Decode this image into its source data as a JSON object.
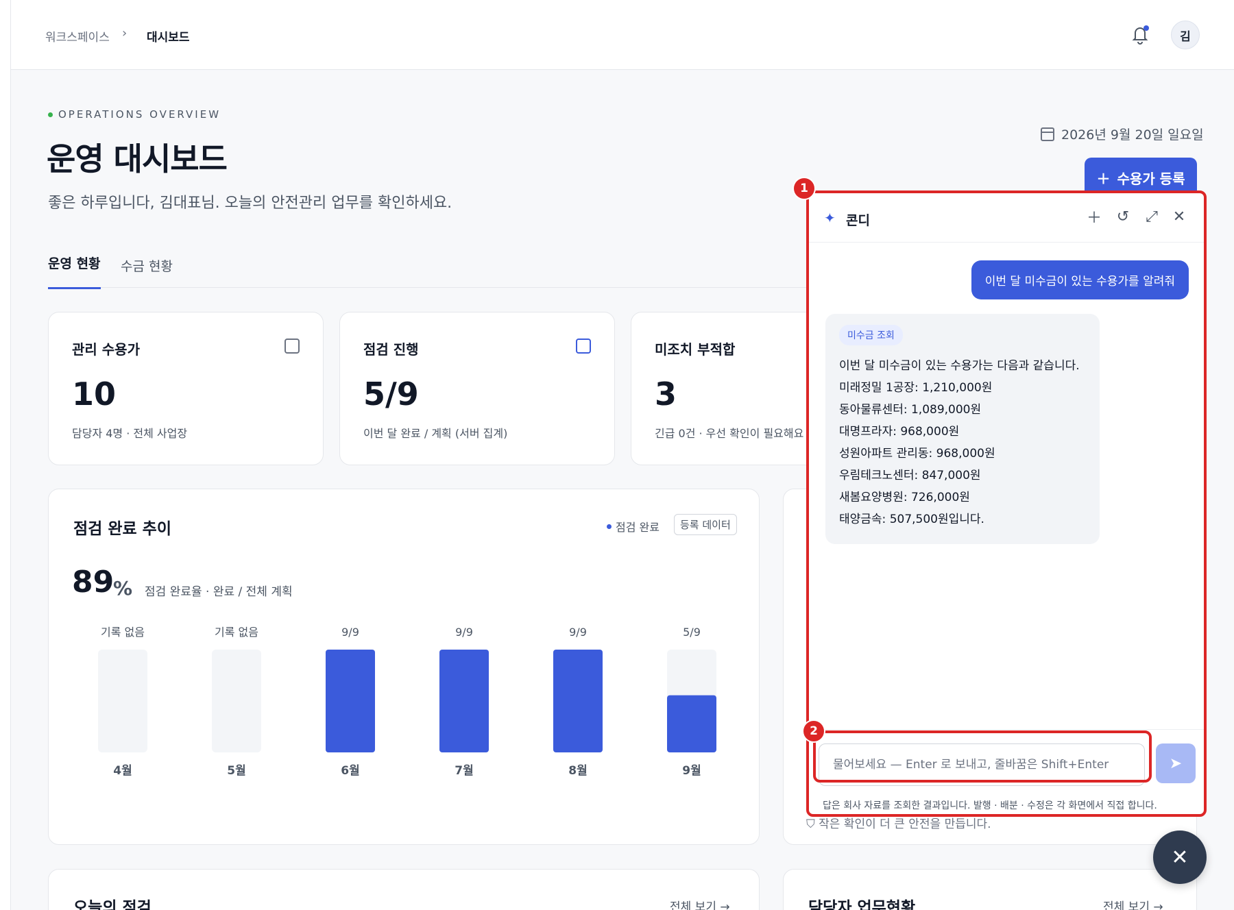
{
  "breadcrumb": {
    "root": "워크스페이스",
    "separator": "›",
    "current": "대시보드"
  },
  "header": {
    "avatar_initial": "김"
  },
  "hero": {
    "eyebrow": "OPERATIONS OVERVIEW",
    "title": "운영 대시보드",
    "subtitle": "좋은 하루입니다, 김대표님. 오늘의 안전관리 업무를 확인하세요.",
    "date": "2026년 9월 20일 일요일",
    "add_button": "수용가 등록"
  },
  "tabs": [
    {
      "label": "운영 현황",
      "active": true
    },
    {
      "label": "수금 현황",
      "active": false
    }
  ],
  "kpis": [
    {
      "title": "관리 수용가",
      "value": "10",
      "sub": "담당자 4명 · 전체 사업장"
    },
    {
      "title": "점검 진행",
      "value": "5/9",
      "sub": "이번 달 완료 / 계획 (서버 집계)"
    },
    {
      "title": "미조치 부적합",
      "value": "3",
      "sub": "긴급 0건 · 우선 확인이 필요해요"
    }
  ],
  "chart_data": {
    "type": "bar",
    "title": "점검 완료 추이",
    "legend": "점검 완료",
    "tag": "등록 데이터",
    "summary_value": "89",
    "summary_unit": "%",
    "summary_note": "점검 완료율 · 완료 / 전체 계획",
    "categories": [
      "4월",
      "5월",
      "6월",
      "7월",
      "8월",
      "9월"
    ],
    "labels": [
      "기록 없음",
      "기록 없음",
      "9/9",
      "9/9",
      "9/9",
      "5/9"
    ],
    "values": [
      0,
      0,
      1.0,
      1.0,
      1.0,
      0.556
    ],
    "ylim": [
      0,
      1
    ],
    "bar_color": "#3b5bdb",
    "track_color": "#f3f5f8"
  },
  "bottom": [
    {
      "title": "오늘의 점검",
      "link": "전체 보기 →"
    },
    {
      "title": "담당자 업무현황",
      "link": "전체 보기 →"
    }
  ],
  "assistant": {
    "name": "콘디",
    "user_message": "이번 달 미수금이 있는 수용가를 알려줘",
    "bot_badge": "미수금 조회",
    "bot_lines": [
      "이번 달 미수금이 있는 수용가는 다음과 같습니다.",
      "미래정밀 1공장: 1,210,000원",
      "동아물류센터: 1,089,000원",
      "대명프라자: 968,000원",
      "성원아파트 관리동: 968,000원",
      "우림테크노센터: 847,000원",
      "새봄요양병원: 726,000원",
      "태양금속: 507,500원입니다."
    ],
    "input_placeholder": "물어보세요 — Enter 로 보내고, 줄바꿈은 Shift+Enter",
    "disclaimer": "답은 회사 자료를 조회한 결과입니다. 발행 · 배분 · 수정은 각 화면에서 직접 합니다.",
    "under_note": "작은 확인이 더 큰 안전을 만듭니다."
  },
  "annotations": {
    "badge_1": "1",
    "badge_2": "2"
  },
  "colors": {
    "accent": "#3b5bdb",
    "highlight": "#dc2626"
  }
}
